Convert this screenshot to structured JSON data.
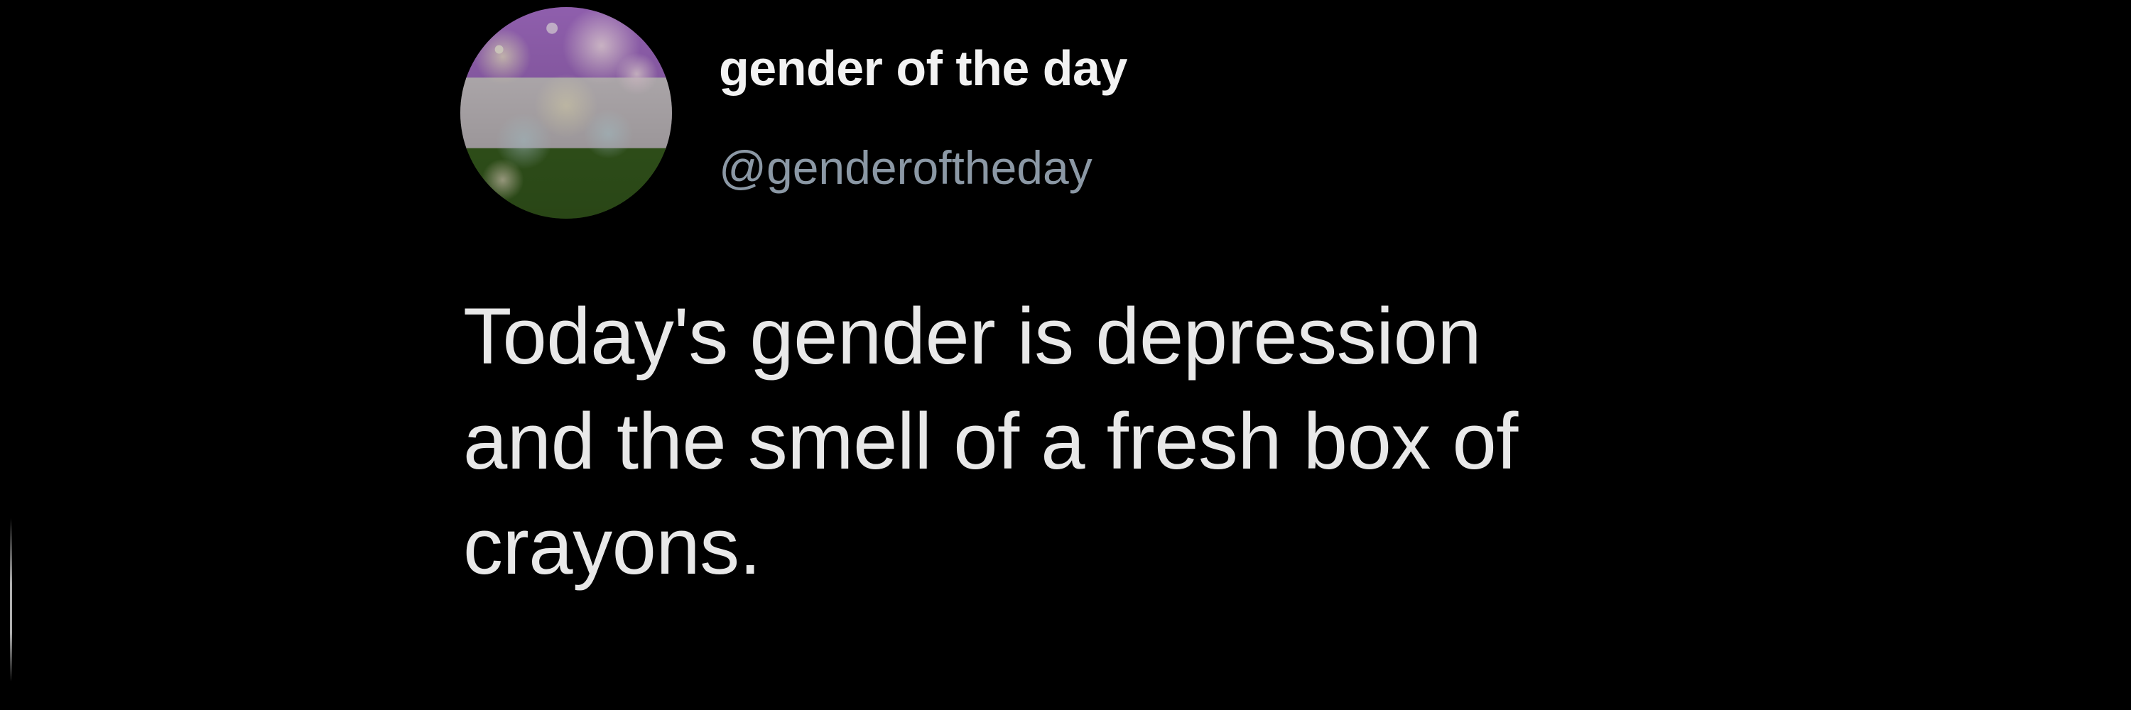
{
  "tweet": {
    "author": {
      "display_name": "gender of the day",
      "handle": "@genderoftheday",
      "avatar_icon": "genderqueer-flag-avatar",
      "avatar_colors": [
        "#b57edc",
        "#ffffff",
        "#4a8123"
      ]
    },
    "text_lines": [
      "Today's gender is depression",
      "and the smell of a fresh box of",
      "crayons."
    ]
  },
  "colors": {
    "background": "#000000",
    "display_name": "#f2f2f2",
    "handle": "#8b98a5",
    "body_text": "#e8e8e8"
  }
}
